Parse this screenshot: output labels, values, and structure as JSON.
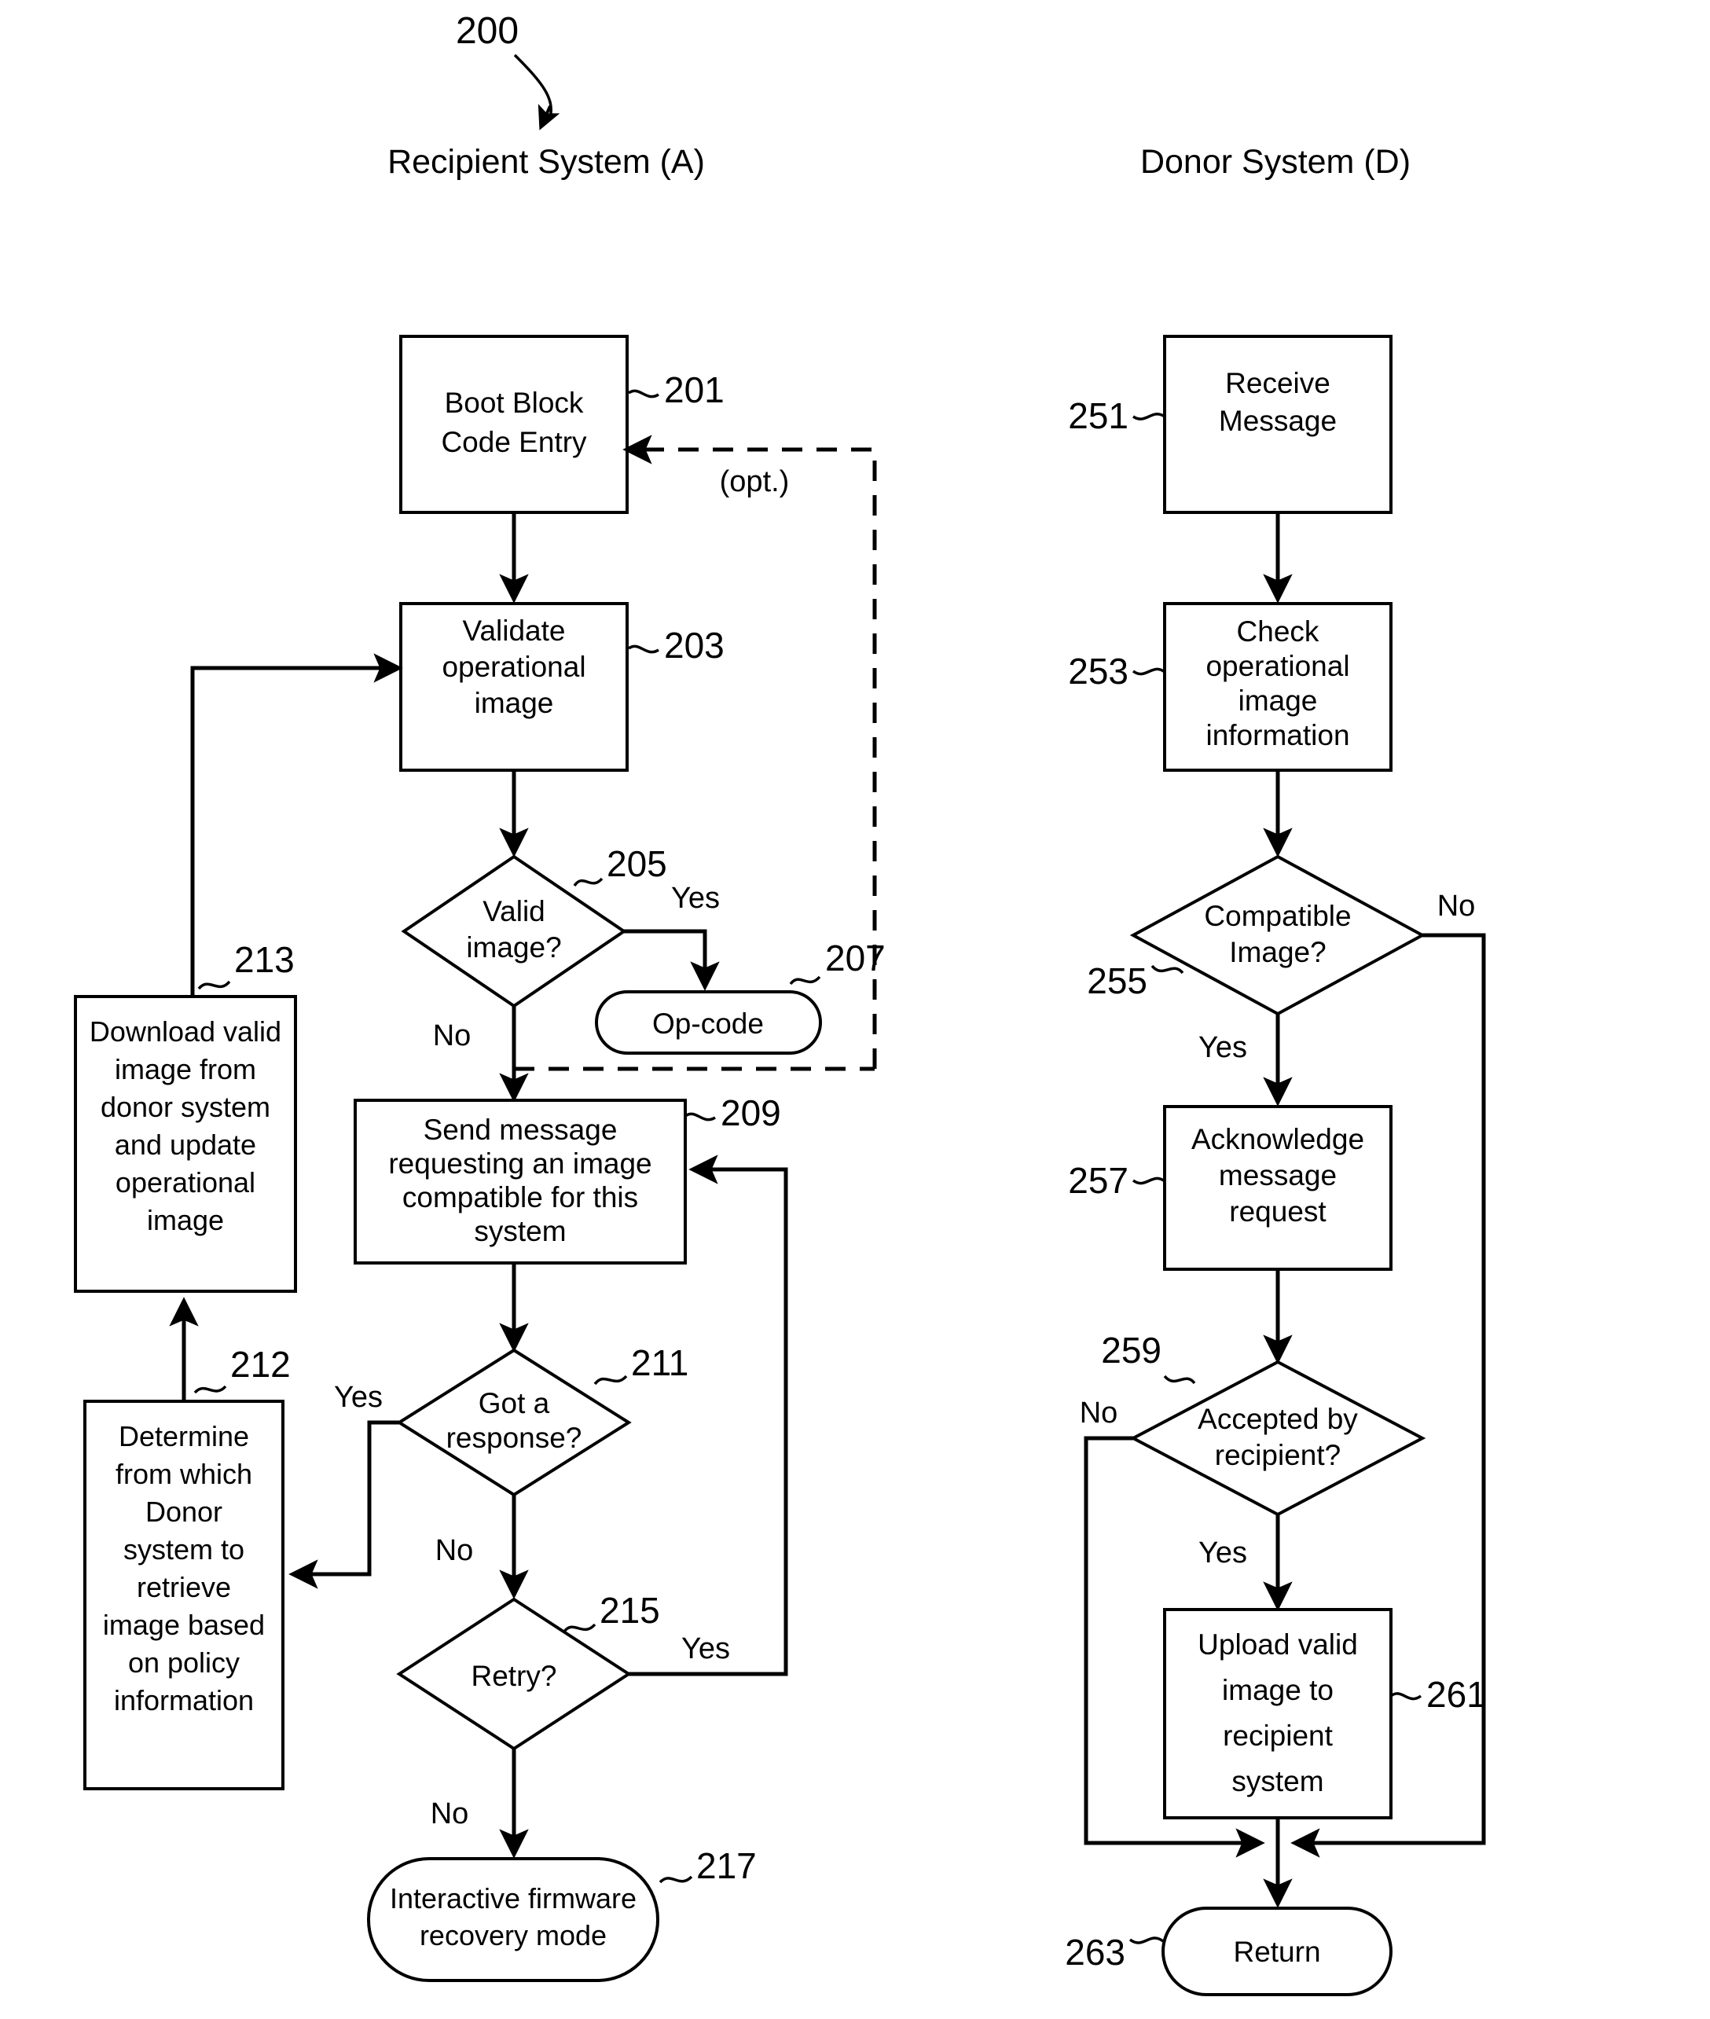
{
  "figure": {
    "number": "200"
  },
  "columns": {
    "recipient_title": "Recipient System (A)",
    "donor_title": "Donor System (D)"
  },
  "recipient": {
    "boot_block": {
      "ref": "201",
      "line1": "Boot Block",
      "line2": "Code Entry"
    },
    "validate": {
      "ref": "203",
      "line1": "Validate",
      "line2": "operational",
      "line3": "image"
    },
    "valid_image": {
      "ref": "205",
      "line1": "Valid",
      "line2": "image?"
    },
    "op_code": {
      "ref": "207",
      "label": "Op-code"
    },
    "send_message": {
      "ref": "209",
      "line1": "Send message",
      "line2": "requesting an image",
      "line3": "compatible for this",
      "line4": "system"
    },
    "got_response": {
      "ref": "211",
      "line1": "Got a",
      "line2": "response?"
    },
    "determine_donor": {
      "ref": "212",
      "line1": "Determine",
      "line2": "from which",
      "line3": "Donor",
      "line4": "system to",
      "line5": "retrieve",
      "line6": "image based",
      "line7": "on policy",
      "line8": "information"
    },
    "download_valid": {
      "ref": "213",
      "line1": "Download valid",
      "line2": "image from",
      "line3": "donor system",
      "line4": "and update",
      "line5": "operational",
      "line6": "image"
    },
    "retry": {
      "ref": "215",
      "label": "Retry?"
    },
    "recovery_mode": {
      "ref": "217",
      "line1": "Interactive firmware",
      "line2": "recovery mode"
    },
    "labels": {
      "valid_yes": "Yes",
      "valid_no": "No",
      "optional": "(opt.)",
      "got_response_yes": "Yes",
      "got_response_no": "No",
      "retry_yes": "Yes",
      "retry_no": "No"
    }
  },
  "donor": {
    "receive_message": {
      "ref": "251",
      "line1": "Receive",
      "line2": "Message"
    },
    "check_image": {
      "ref": "253",
      "line1": "Check",
      "line2": "operational",
      "line3": "image",
      "line4": "information"
    },
    "compatible_image": {
      "ref": "255",
      "line1": "Compatible",
      "line2": "Image?"
    },
    "acknowledge": {
      "ref": "257",
      "line1": "Acknowledge",
      "line2": "message",
      "line3": "request"
    },
    "accepted": {
      "ref": "259",
      "line1": "Accepted by",
      "line2": "recipient?"
    },
    "upload_valid": {
      "ref": "261",
      "line1": "Upload valid",
      "line2": "image to",
      "line3": "recipient",
      "line4": "system"
    },
    "return_node": {
      "ref": "263",
      "label": "Return"
    },
    "labels": {
      "compatible_no": "No",
      "compatible_yes": "Yes",
      "accepted_no": "No",
      "accepted_yes": "Yes"
    }
  },
  "colors": {
    "ink": "#000000",
    "paper": "#ffffff"
  }
}
